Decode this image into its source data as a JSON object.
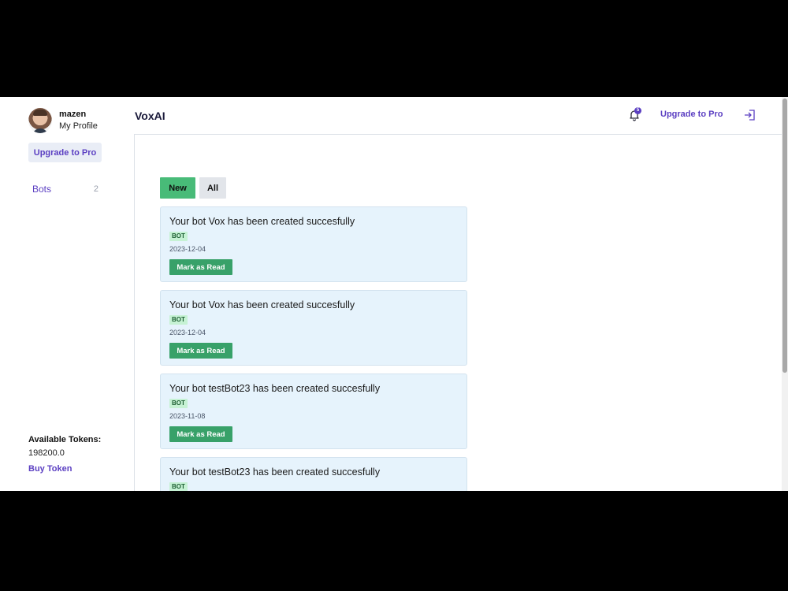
{
  "profile": {
    "name": "mazen",
    "link": "My Profile",
    "upgrade_label": "Upgrade to Pro"
  },
  "sidebar": {
    "items": [
      {
        "label": "Bots",
        "count": "2",
        "icon": "none"
      }
    ]
  },
  "tokens": {
    "label": "Available Tokens:",
    "value": "198200.0",
    "buy_label": "Buy Token"
  },
  "header": {
    "brand": "VoxAI",
    "notification_count": "5",
    "upgrade_label": "Upgrade to Pro",
    "bell_icon": "bell-icon",
    "logout_icon": "logout-icon"
  },
  "tabs": [
    {
      "label": "New",
      "active": true
    },
    {
      "label": "All",
      "active": false
    }
  ],
  "notifications": [
    {
      "title": "Your bot Vox has been created succesfully",
      "tag": "BOT",
      "date": "2023-12-04",
      "action": "Mark as Read"
    },
    {
      "title": "Your bot Vox has been created succesfully",
      "tag": "BOT",
      "date": "2023-12-04",
      "action": "Mark as Read"
    },
    {
      "title": "Your bot testBot23 has been created succesfully",
      "tag": "BOT",
      "date": "2023-11-08",
      "action": "Mark as Read"
    },
    {
      "title": "Your bot testBot23 has been created succesfully",
      "tag": "BOT",
      "date": "",
      "action": ""
    }
  ],
  "colors": {
    "accent": "#5b3fc2",
    "new_tab": "#48bb78",
    "mark_read_button": "#38a169",
    "card_background": "#e6f3fc"
  }
}
